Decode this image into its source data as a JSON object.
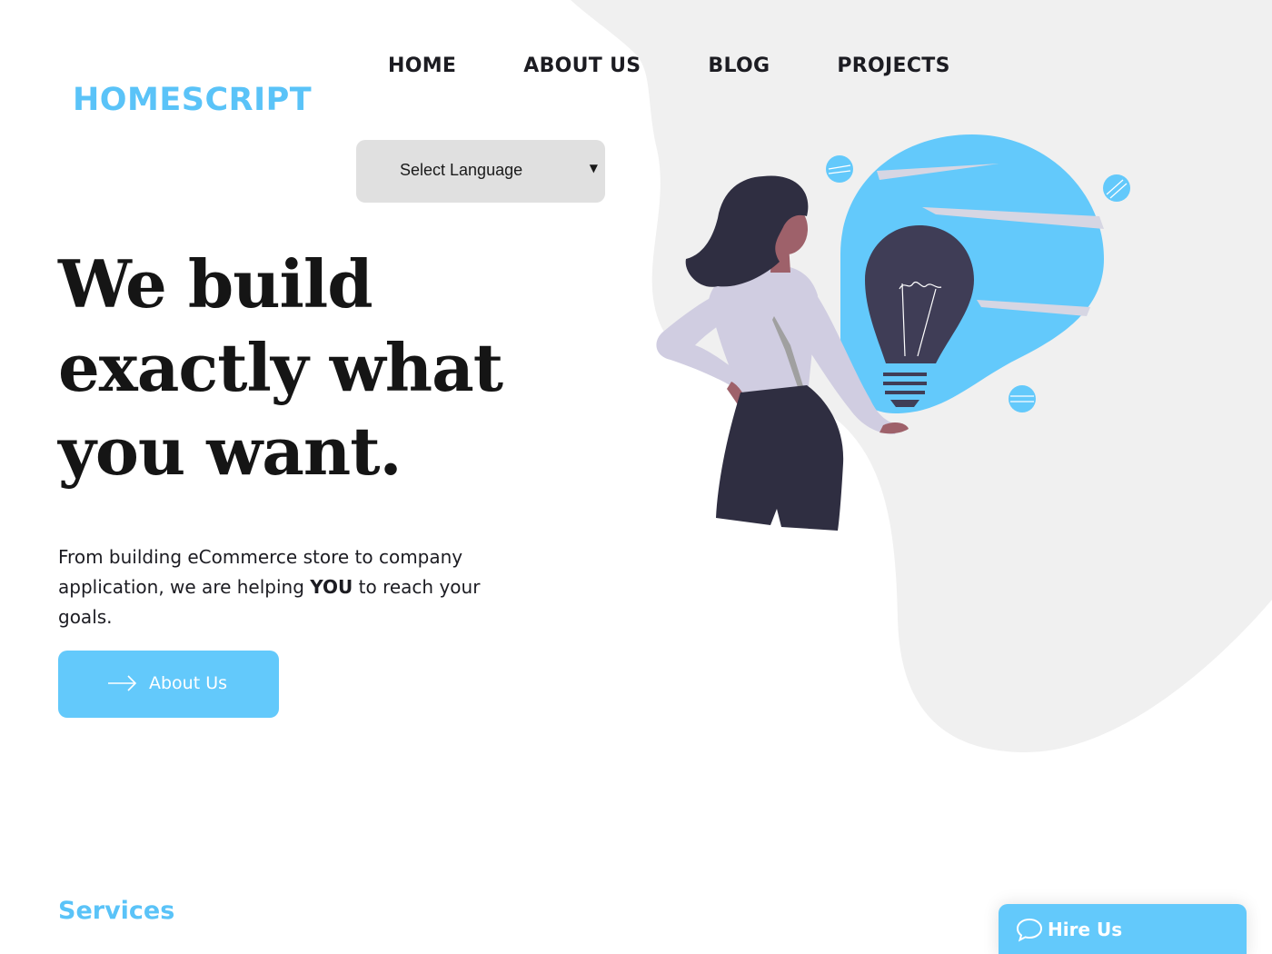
{
  "brand": {
    "logo_text": "HOMESCRIPT"
  },
  "nav": {
    "items": [
      {
        "label": "HOME"
      },
      {
        "label": "ABOUT US"
      },
      {
        "label": "BLOG"
      },
      {
        "label": "PROJECTS"
      }
    ]
  },
  "language_select": {
    "selected": "Select Language"
  },
  "hero": {
    "title_lines": [
      "We build",
      "exactly what",
      "you want."
    ],
    "text_before": "From building eCommerce store to company application, we are helping ",
    "text_emphasis": "YOU",
    "text_after": " to reach your goals.",
    "cta_label": "About Us",
    "cta_icon": "arrow-right-icon"
  },
  "illustration": {
    "subject": "woman-with-lightbulb-icon"
  },
  "sections": {
    "services_heading": "Services"
  },
  "hire_widget": {
    "label": "Hire Us",
    "icon": "chat-bubble-icon"
  },
  "colors": {
    "accent": "#5ac3f8",
    "button": "#63c9fb",
    "blob": "#f0f0f0",
    "text": "#151515"
  }
}
